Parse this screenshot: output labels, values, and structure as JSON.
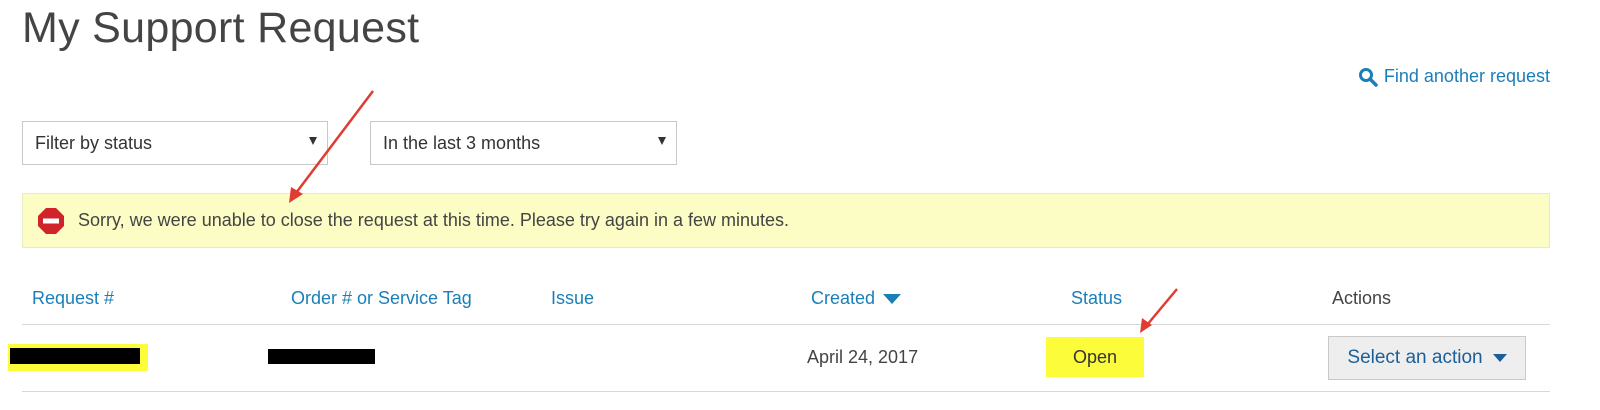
{
  "page": {
    "title": "My Support Request"
  },
  "find_link": {
    "label": "Find another request",
    "icon": "search-icon",
    "color": "#1a7fb8"
  },
  "filters": {
    "status": {
      "selected": "Filter by status"
    },
    "date_range": {
      "selected": "In the last 3 months"
    }
  },
  "alert": {
    "icon": "stop-icon",
    "message": "Sorry, we were unable to close the request at this time. Please try again in a few minutes.",
    "background": "#fcfcc5"
  },
  "table": {
    "columns": [
      {
        "label": "Request #",
        "sortable": true
      },
      {
        "label": "Order # or Service Tag",
        "sortable": true
      },
      {
        "label": "Issue",
        "sortable": true
      },
      {
        "label": "Created",
        "sortable": true,
        "sorted": "descending"
      },
      {
        "label": "Status",
        "sortable": true
      },
      {
        "label": "Actions",
        "sortable": false
      }
    ],
    "rows": [
      {
        "request_number": "[redacted]",
        "order_or_service_tag": "[redacted]",
        "issue": "",
        "created": "April 24, 2017",
        "status": "Open",
        "action_label": "Select an action"
      }
    ]
  },
  "colors": {
    "link": "#1a7fb8",
    "highlight": "#fcfc3a",
    "annotation_arrow": "#e03c31"
  }
}
